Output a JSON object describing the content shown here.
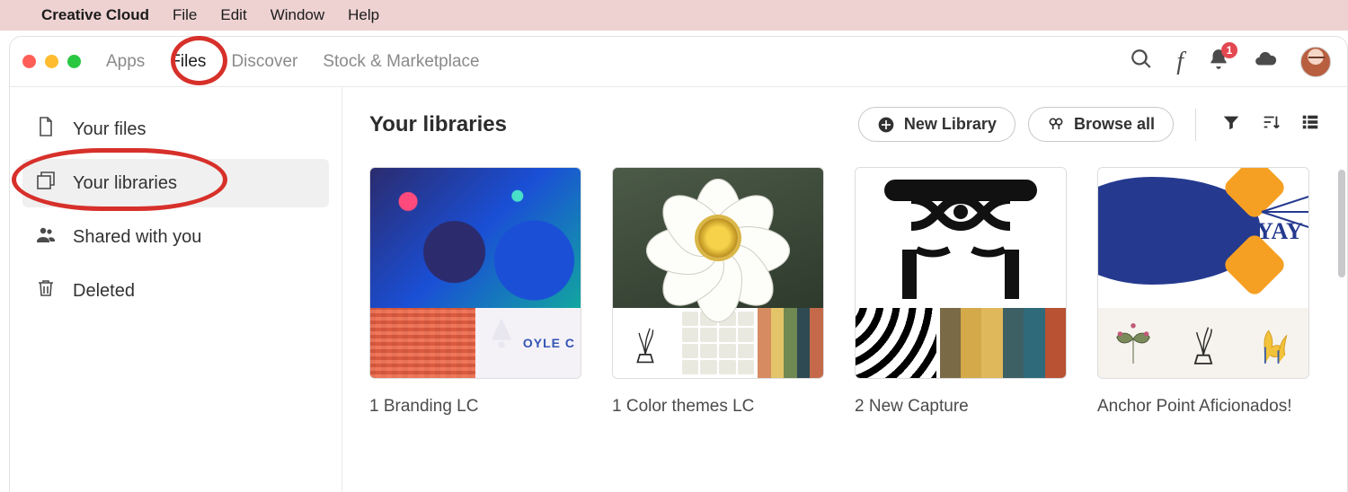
{
  "menubar": {
    "apple": "",
    "app_name": "Creative Cloud",
    "items": [
      "File",
      "Edit",
      "Window",
      "Help"
    ]
  },
  "app_tabs": {
    "items": [
      "Apps",
      "Files",
      "Discover",
      "Stock & Marketplace"
    ],
    "active_index": 1
  },
  "notifications": {
    "count": "1"
  },
  "sidebar": {
    "items": [
      {
        "label": "Your files"
      },
      {
        "label": "Your libraries"
      },
      {
        "label": "Shared with you"
      },
      {
        "label": "Deleted"
      }
    ],
    "active_index": 1
  },
  "content": {
    "title": "Your libraries",
    "new_library_label": "New Library",
    "browse_all_label": "Browse all"
  },
  "libraries": [
    {
      "name": "1 Branding LC",
      "art_text": "OYLE C"
    },
    {
      "name": "1 Color themes LC"
    },
    {
      "name": "2 New Capture"
    },
    {
      "name": "Anchor Point Aficionados!",
      "art_text": "YAY ILL"
    }
  ],
  "palettes": {
    "lib2": [
      "#d68b60",
      "#e3c469",
      "#708851",
      "#2f4a52",
      "#c46a4a"
    ],
    "lib3": [
      "#7a6a46",
      "#d4a94a",
      "#e0b85c",
      "#3d6064",
      "#2f6a7a",
      "#b85232"
    ]
  },
  "annotations": {
    "tab_files_highlighted": true,
    "sidebar_libraries_highlighted": true
  }
}
